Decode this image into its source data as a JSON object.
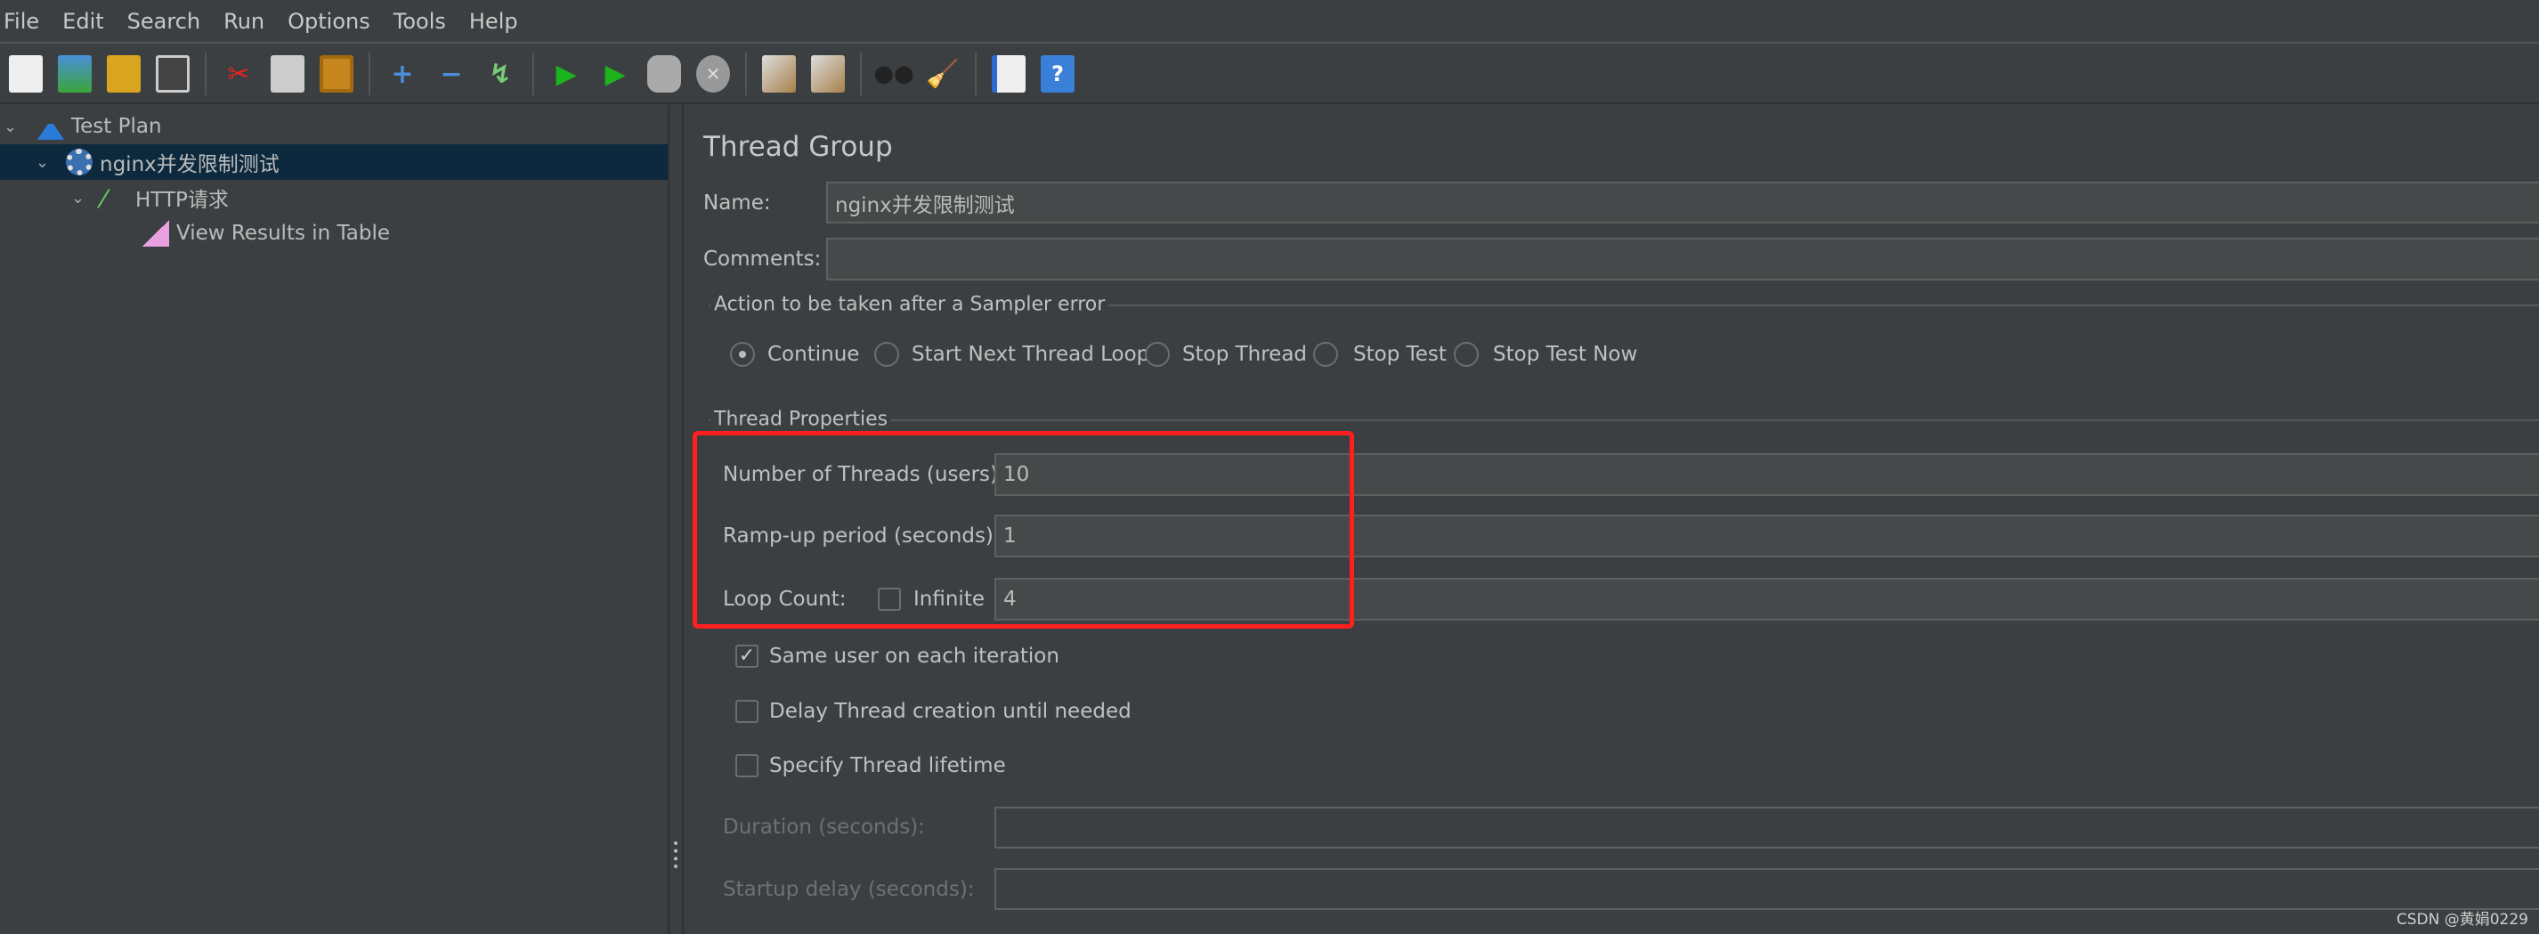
{
  "menu": [
    "File",
    "Edit",
    "Search",
    "Run",
    "Options",
    "Tools",
    "Help"
  ],
  "toolbar": {
    "icons": [
      "new-icon",
      "templates-icon",
      "open-icon",
      "save-icon",
      "cut-icon",
      "copy-icon",
      "paste-icon",
      "expand-icon",
      "collapse-icon",
      "toggle-icon",
      "start-icon",
      "start-no-pauses-icon",
      "stop-icon",
      "shutdown-icon",
      "clear-icon",
      "clear-all-icon",
      "search-icon",
      "reset-search-icon",
      "function-helper-icon",
      "help-icon"
    ]
  },
  "tree": {
    "items": [
      {
        "label": "Test Plan"
      },
      {
        "label": "nginx并发限制测试"
      },
      {
        "label": "HTTP请求"
      },
      {
        "label": "View Results in Table"
      }
    ]
  },
  "panel": {
    "title": "Thread Group",
    "name_label": "Name:",
    "name_value": "nginx并发限制测试",
    "comments_label": "Comments:",
    "comments_value": "",
    "action_title": "Action to be taken after a Sampler error",
    "actions": [
      "Continue",
      "Start Next Thread Loop",
      "Stop Thread",
      "Stop Test",
      "Stop Test Now"
    ],
    "selected_action": "Continue",
    "props_title": "Thread Properties",
    "threads_label": "Number of Threads (users):",
    "threads_value": "10",
    "rampup_label": "Ramp-up period (seconds):",
    "rampup_value": "1",
    "loop_label": "Loop Count:",
    "infinite_label": "Infinite",
    "infinite_checked": false,
    "loop_value": "4",
    "same_user_label": "Same user on each iteration",
    "same_user_checked": true,
    "delay_label": "Delay Thread creation until needed",
    "delay_checked": false,
    "lifetime_label": "Specify Thread lifetime",
    "lifetime_checked": false,
    "duration_label": "Duration (seconds):",
    "duration_value": "",
    "startup_label": "Startup delay (seconds):",
    "startup_value": ""
  },
  "watermark": "CSDN @黄娟0229",
  "colors": {
    "highlight": "#ff1f1f",
    "selection": "#0d293e",
    "background": "#3c3f41"
  }
}
